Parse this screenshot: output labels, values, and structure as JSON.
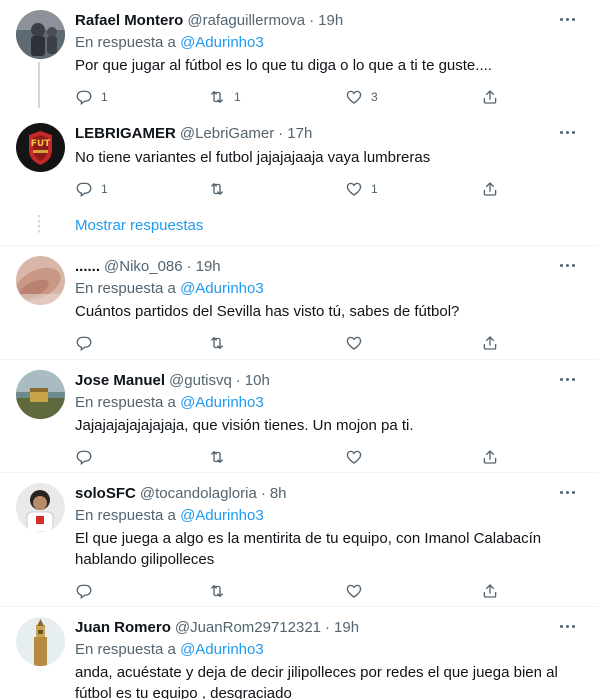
{
  "accent_color": "#1d9bf0",
  "replying_to_label": "En respuesta a",
  "show_replies_label": "Mostrar respuestas",
  "tweets": [
    {
      "name": "Rafael Montero",
      "handle": "@rafaguillermova",
      "time": "19h",
      "reply_to": "@Adurinho3",
      "text": "Por que jugar al fútbol es lo que tu diga o lo que a ti te guste....",
      "replies": "1",
      "retweets": "1",
      "likes": "3"
    },
    {
      "name": "LEBRIGAMER",
      "handle": "@LebriGamer",
      "time": "17h",
      "reply_to": "",
      "text": "No tiene variantes el futbol jajajajaaja vaya lumbreras",
      "replies": "1",
      "retweets": "",
      "likes": "1",
      "avatar_logo_text": "FUT"
    },
    {
      "name": "......",
      "handle": "@Niko_086",
      "time": "19h",
      "reply_to": "@Adurinho3",
      "text": "Cuántos partidos del Sevilla has visto tú, sabes de fútbol?",
      "replies": "",
      "retweets": "",
      "likes": ""
    },
    {
      "name": "Jose Manuel",
      "handle": "@gutisvq",
      "time": "10h",
      "reply_to": "@Adurinho3",
      "text": "Jajajajajajajajaja, que visión tienes. Un mojon pa ti.",
      "replies": "",
      "retweets": "",
      "likes": ""
    },
    {
      "name": "soloSFC",
      "handle": "@tocandolagloria",
      "time": "8h",
      "reply_to": "@Adurinho3",
      "text": "El que juega a algo es la mentirita de tu equipo, con Imanol Calabacín hablando gilipolleces",
      "replies": "",
      "retweets": "",
      "likes": ""
    },
    {
      "name": "Juan Romero",
      "handle": "@JuanRom29712321",
      "time": "19h",
      "reply_to": "@Adurinho3",
      "text": "anda, acuéstate y deja de decir jilipolleces por redes el que juega bien al fútbol es tu equipo , desgraciado",
      "replies": "",
      "retweets": "",
      "likes": ""
    }
  ]
}
